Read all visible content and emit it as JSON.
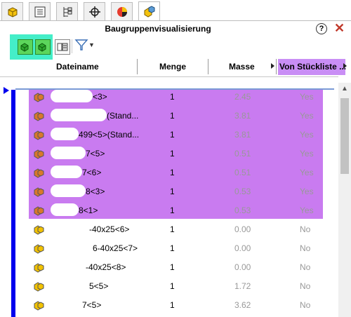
{
  "tabs": [
    {
      "icon": "featuremanager-icon"
    },
    {
      "icon": "propertymanager-icon"
    },
    {
      "icon": "configurationmanager-icon"
    },
    {
      "icon": "dimxpert-icon"
    },
    {
      "icon": "display-manager-icon"
    },
    {
      "icon": "assembly-visualization-icon",
      "active": true
    }
  ],
  "panel": {
    "title": "Baugruppenvisualisierung",
    "help_icon": "?",
    "close_icon": "✕"
  },
  "columns": {
    "name": "Dateiname",
    "qty": "Menge",
    "mass": "Masse",
    "bom": "Von Stückliste ..."
  },
  "rows": [
    {
      "name": "<3>",
      "qty": "1",
      "mass": "2.45",
      "bom": "Yes",
      "icon_color": "#d9782a"
    },
    {
      "name": "(Stand...",
      "qty": "1",
      "mass": "3.81",
      "bom": "Yes",
      "icon_color": "#d9782a"
    },
    {
      "name": "499<5>(Stand...",
      "qty": "1",
      "mass": "3.81",
      "bom": "Yes",
      "icon_color": "#d9782a"
    },
    {
      "name": "7<5>",
      "qty": "1",
      "mass": "0.51",
      "bom": "Yes",
      "icon_color": "#d9782a"
    },
    {
      "name": "7<6>",
      "qty": "1",
      "mass": "0.51",
      "bom": "Yes",
      "icon_color": "#d9782a"
    },
    {
      "name": "8<3>",
      "qty": "1",
      "mass": "0.53",
      "bom": "Yes",
      "icon_color": "#d9782a"
    },
    {
      "name": "8<1>",
      "qty": "1",
      "mass": "0.53",
      "bom": "Yes",
      "icon_color": "#d9782a"
    },
    {
      "name": "-40x25<6>",
      "qty": "1",
      "mass": "0.00",
      "bom": "No",
      "icon_color": "#f2c200"
    },
    {
      "name": "6-40x25<7>",
      "qty": "1",
      "mass": "0.00",
      "bom": "No",
      "icon_color": "#f2c200"
    },
    {
      "name": "-40x25<8>",
      "qty": "1",
      "mass": "0.00",
      "bom": "No",
      "icon_color": "#f2c200"
    },
    {
      "name": "5<5>",
      "qty": "1",
      "mass": "1.72",
      "bom": "No",
      "icon_color": "#f2c200"
    },
    {
      "name": "7<5>",
      "qty": "1",
      "mass": "3.62",
      "bom": "No",
      "icon_color": "#f2c200"
    }
  ],
  "colors": {
    "selection": "#c97bf0",
    "toolbar_highlight": "#44eec8",
    "marker": "#0000ee"
  }
}
